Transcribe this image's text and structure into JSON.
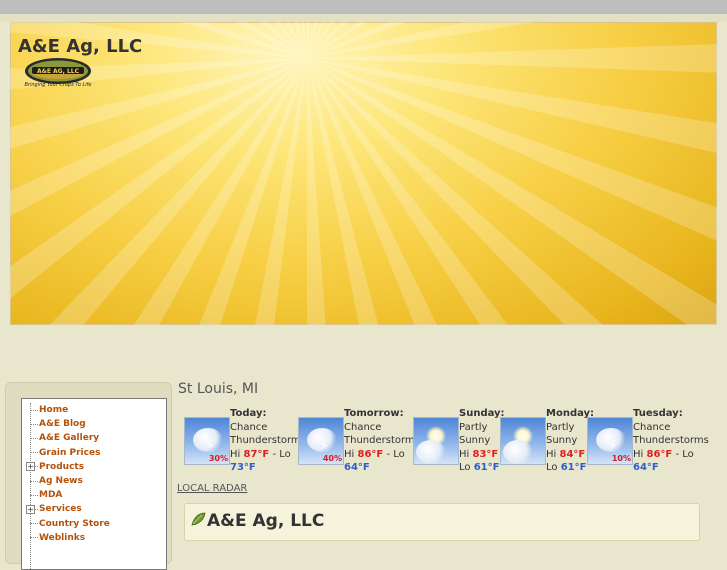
{
  "header": {
    "site_title": "A&E Ag, LLC",
    "logo_word": "A&E AG, LLC",
    "logo_tagline": "Bringing Your Crops To Life"
  },
  "menu": {
    "items": [
      {
        "label": "Home",
        "expandable": false
      },
      {
        "label": "A&E Blog",
        "expandable": false
      },
      {
        "label": "A&E Gallery",
        "expandable": false
      },
      {
        "label": "Grain Prices",
        "expandable": false
      },
      {
        "label": "Products",
        "expandable": true
      },
      {
        "label": "Ag News",
        "expandable": false
      },
      {
        "label": "MDA",
        "expandable": false
      },
      {
        "label": "Services",
        "expandable": true
      },
      {
        "label": "Country Store",
        "expandable": false
      },
      {
        "label": "Weblinks",
        "expandable": false
      }
    ]
  },
  "weather": {
    "city": "St Louis, MI",
    "days": [
      {
        "day": "Today:",
        "cond1": "Chance",
        "cond2": "Thunderstorms",
        "hi_label": "Hi",
        "hi": "87°F",
        "sep": "- Lo",
        "lo": "73°F",
        "pct": "30%",
        "icon": "thunderstorm-icon"
      },
      {
        "day": "Tomorrow:",
        "cond1": "Chance",
        "cond2": "Thunderstorms",
        "hi_label": "Hi",
        "hi": "86°F",
        "sep": "- Lo",
        "lo": "64°F",
        "pct": "40%",
        "icon": "thunderstorm-icon"
      },
      {
        "day": "Sunday:",
        "cond1": "Partly",
        "cond2": "Sunny",
        "hi_label": "Hi",
        "hi": "83°F",
        "sep": "-",
        "lo_label": "Lo",
        "lo": "61°F",
        "pct": "",
        "icon": "partly-sunny-icon"
      },
      {
        "day": "Monday:",
        "cond1": "Partly",
        "cond2": "Sunny",
        "hi_label": "Hi",
        "hi": "84°F",
        "sep": "-",
        "lo_label": "Lo",
        "lo": "61°F",
        "pct": "",
        "icon": "partly-sunny-icon"
      },
      {
        "day": "Tuesday:",
        "cond1": "Chance",
        "cond2": "Thunderstorms",
        "hi_label": "Hi",
        "hi": "86°F",
        "sep": "- Lo",
        "lo": "64°F",
        "pct": "10%",
        "icon": "thunderstorm-icon"
      }
    ],
    "radar_link": "LOCAL RADAR"
  },
  "article": {
    "title": "A&E Ag, LLC"
  },
  "colors": {
    "menu_link": "#b5520a",
    "hi_temp": "#e0201e",
    "lo_temp": "#2f5ec8",
    "banner_gold": "#f7cf45"
  }
}
